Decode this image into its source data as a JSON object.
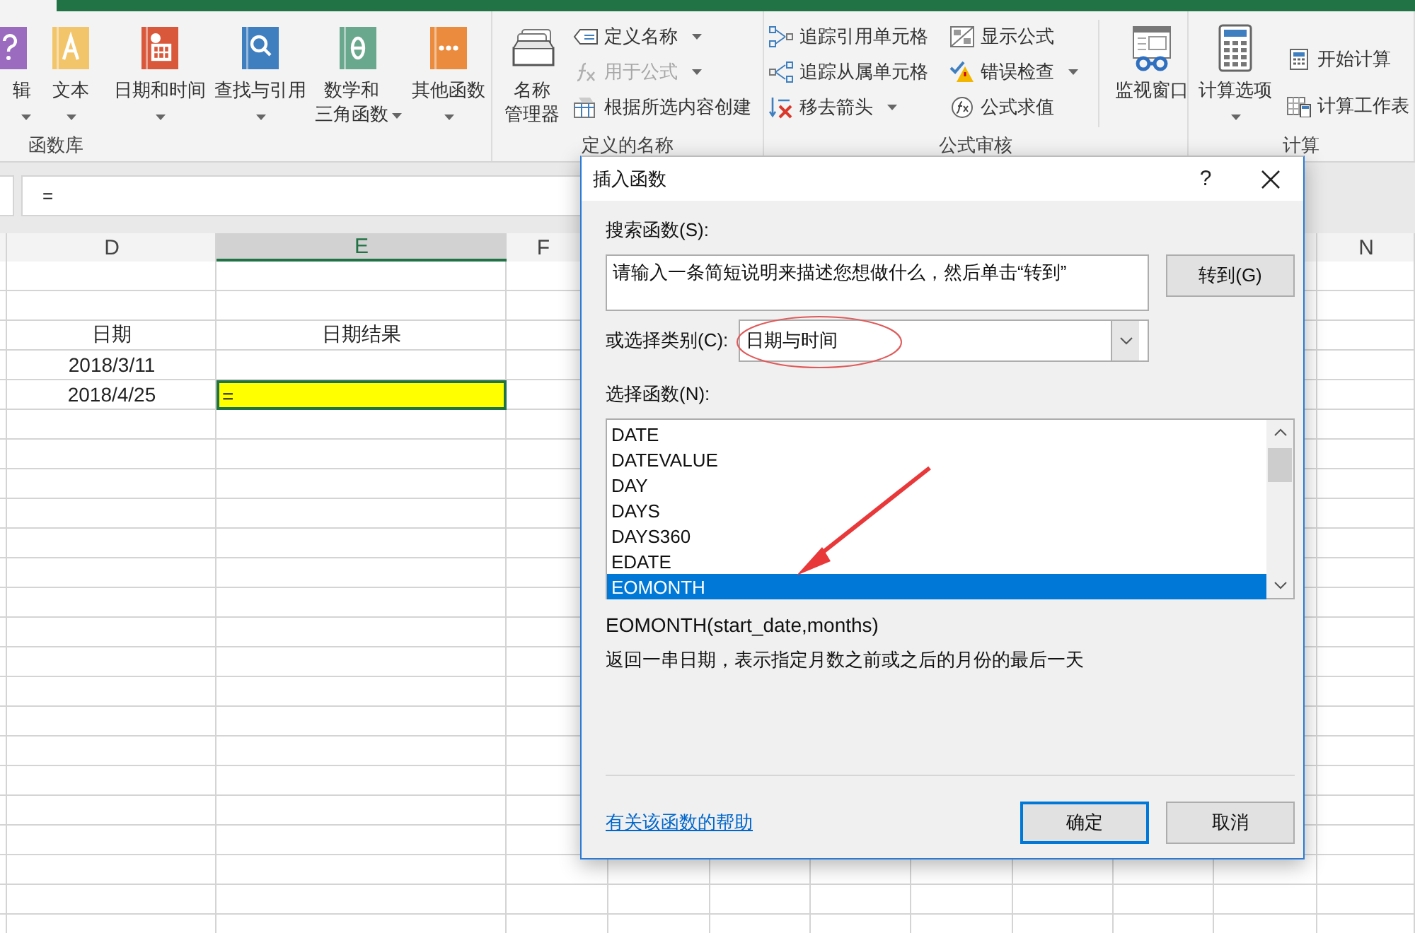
{
  "ribbon": {
    "groups": [
      {
        "label": "函数库",
        "items": [
          {
            "kind": "large",
            "lines": [
              "辑"
            ],
            "dropdown": true
          },
          {
            "kind": "large",
            "lines": [
              "文本"
            ],
            "dropdown": true
          },
          {
            "kind": "large",
            "lines": [
              "日期和时间"
            ],
            "dropdown": true
          },
          {
            "kind": "large",
            "lines": [
              "查找与引用"
            ],
            "dropdown": true
          },
          {
            "kind": "large",
            "lines": [
              "数学和",
              "三角函数"
            ],
            "dropdown": true
          },
          {
            "kind": "large",
            "lines": [
              "其他函数"
            ],
            "dropdown": true
          }
        ]
      },
      {
        "label": "定义的名称",
        "items": [
          {
            "kind": "large",
            "lines": [
              "名称",
              "管理器"
            ],
            "dropdown": false
          },
          {
            "kind": "stack",
            "buttons": [
              {
                "label": "定义名称",
                "dropdown": true,
                "disabled": false
              },
              {
                "label": "用于公式",
                "dropdown": true,
                "disabled": true
              },
              {
                "label": "根据所选内容创建",
                "dropdown": false,
                "disabled": false
              }
            ]
          }
        ]
      },
      {
        "label": "公式审核",
        "items": [
          {
            "kind": "stack",
            "buttons": [
              {
                "label": "追踪引用单元格",
                "dropdown": false,
                "disabled": false
              },
              {
                "label": "追踪从属单元格",
                "dropdown": false,
                "disabled": false
              },
              {
                "label": "移去箭头",
                "dropdown": true,
                "disabled": false
              }
            ]
          },
          {
            "kind": "stack",
            "buttons": [
              {
                "label": "显示公式",
                "dropdown": false,
                "disabled": false
              },
              {
                "label": "错误检查",
                "dropdown": true,
                "disabled": false
              },
              {
                "label": "公式求值",
                "dropdown": false,
                "disabled": false
              }
            ]
          },
          {
            "kind": "separator"
          },
          {
            "kind": "large",
            "lines": [
              "监视窗口"
            ],
            "dropdown": false
          }
        ]
      },
      {
        "label": "计算",
        "items": [
          {
            "kind": "large",
            "lines": [
              "计算选项"
            ],
            "dropdown": true
          },
          {
            "kind": "stack",
            "buttons": [
              {
                "label": "开始计算",
                "dropdown": false,
                "disabled": false
              },
              {
                "label": "计算工作表",
                "dropdown": false,
                "disabled": false
              }
            ]
          }
        ]
      }
    ]
  },
  "formula_bar": {
    "value": "="
  },
  "sheet": {
    "columns": [
      {
        "label": "D",
        "selected": false
      },
      {
        "label": "E",
        "selected": true
      },
      {
        "label": "F",
        "selected": false
      },
      {
        "label": "N",
        "selected": false
      }
    ],
    "rows": [
      {
        "cells": [
          {
            "text": "日期",
            "selected": false
          },
          {
            "text": "日期结果",
            "selected": false
          }
        ]
      },
      {
        "cells": [
          {
            "text": "2018/3/11",
            "selected": false
          }
        ]
      },
      {
        "cells": [
          {
            "text": "2018/4/25",
            "selected": false
          },
          {
            "text": "=",
            "selected": true,
            "color": "#ffff00"
          }
        ]
      }
    ]
  },
  "dialog": {
    "title": "插入函数",
    "help": "?",
    "search": {
      "label": "搜索函数(S):",
      "value": "请输入一条简短说明来描述您想做什么，然后单击“转到”",
      "button": "转到(G)"
    },
    "category": {
      "label": "或选择类别(C):",
      "value": "日期与时间"
    },
    "functions": {
      "label": "选择函数(N):",
      "items": [
        {
          "label": "DATE",
          "selected": false
        },
        {
          "label": "DATEVALUE",
          "selected": false
        },
        {
          "label": "DAY",
          "selected": false
        },
        {
          "label": "DAYS",
          "selected": false
        },
        {
          "label": "DAYS360",
          "selected": false
        },
        {
          "label": "EDATE",
          "selected": false
        },
        {
          "label": "EOMONTH",
          "selected": true
        }
      ]
    },
    "signature": "EOMONTH(start_date,months)",
    "description": "返回一串日期，表示指定月数之前或之后的月份的最后一天",
    "help_link": "有关该函数的帮助",
    "buttons": [
      {
        "label": "确定",
        "default": true
      },
      {
        "label": "取消",
        "default": false
      }
    ]
  }
}
